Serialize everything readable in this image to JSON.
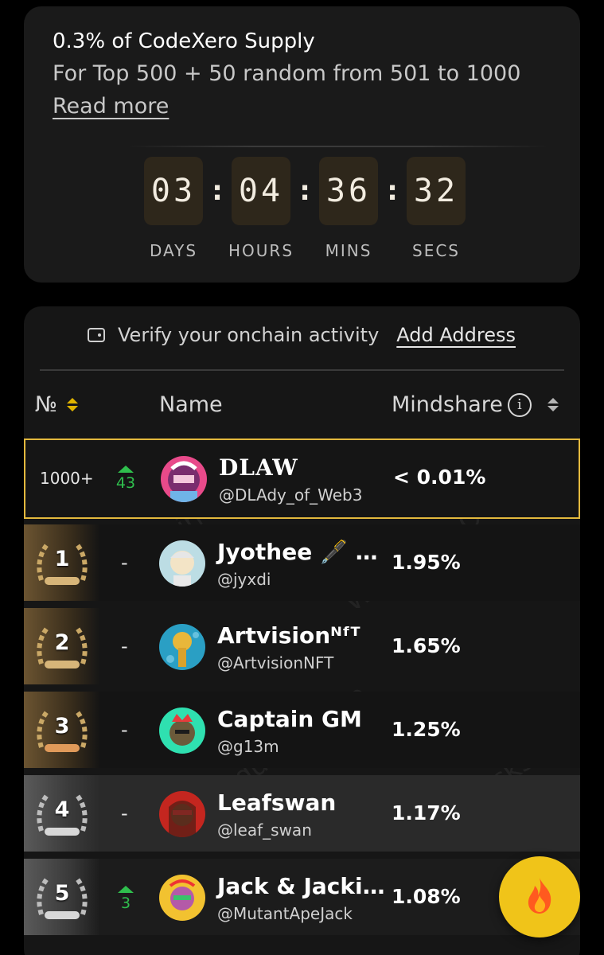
{
  "campaign": {
    "title": "0.3% of CodeXero Supply",
    "subtitle": "For Top 500 + 50 random from 501 to 1000",
    "read_more": "Read more"
  },
  "countdown": {
    "days": "03",
    "hours": "04",
    "mins": "36",
    "secs": "32",
    "separator": ":",
    "days_label": "DAYS",
    "hours_label": "HOURS",
    "mins_label": "MINS",
    "secs_label": "SECS"
  },
  "verify": {
    "text": "Verify your onchain activity",
    "link": "Add Address",
    "icon": "wallet-icon"
  },
  "table": {
    "col_no": "№",
    "col_name": "Name",
    "col_mindshare": "Mindshare",
    "info_glyph": "i"
  },
  "me": {
    "rank": "1000+",
    "delta": "43",
    "name": "DLAW",
    "handle": "@DLAdy_of_Web3",
    "share": "< 0.01%"
  },
  "rows": [
    {
      "rank": "1",
      "delta": "-",
      "name": "Jyothee 🖋️ …",
      "handle": "@jyxdi",
      "share": "1.95%",
      "medal": "gold"
    },
    {
      "rank": "2",
      "delta": "-",
      "name": "Artvisionᴺᶠᵀ",
      "handle": "@ArtvisionNFT",
      "share": "1.65%",
      "medal": "gold"
    },
    {
      "rank": "3",
      "delta": "-",
      "name": "Captain GM",
      "handle": "@g13m",
      "share": "1.25%",
      "medal": "gold"
    },
    {
      "rank": "4",
      "delta": "-",
      "name": "Leafswan",
      "handle": "@leaf_swan",
      "share": "1.17%",
      "medal": "silver"
    },
    {
      "rank": "5",
      "delta": "3",
      "name": "Jack & Jacki…",
      "handle": "@MutantApeJack",
      "share": "1.08%",
      "medal": "silver"
    }
  ],
  "fab": {
    "icon": "flame-icon"
  },
  "colors": {
    "accent": "#e3b93d",
    "up": "#2fbf4d",
    "fab": "#f0c419"
  }
}
